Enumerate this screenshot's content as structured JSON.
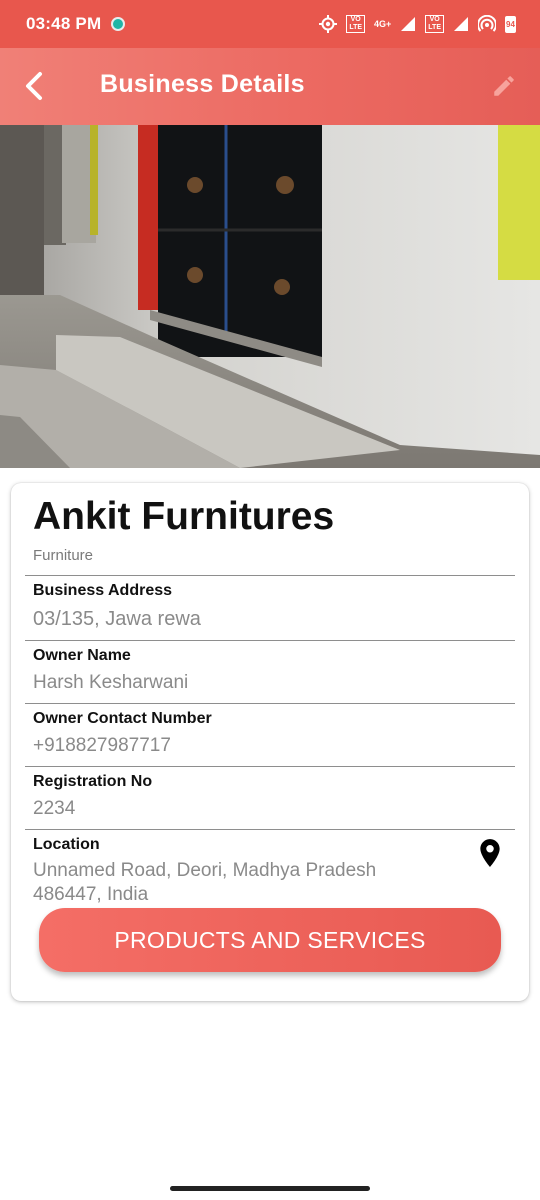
{
  "status_bar": {
    "time": "03:48 PM",
    "network_1": "VO\nLTE",
    "network_tag": "4G+",
    "network_2": "VO\nLTE",
    "battery": "94"
  },
  "app_bar": {
    "title": "Business Details",
    "back_icon": "chevron-left-icon",
    "edit_icon": "pencil-icon"
  },
  "business": {
    "name": "Ankit Furnitures",
    "category": "Furniture"
  },
  "fields": {
    "address": {
      "label": "Business Address",
      "value": "03/135, Jawa rewa"
    },
    "owner": {
      "label": "Owner Name",
      "value": "Harsh Kesharwani"
    },
    "contact": {
      "label": "Owner Contact Number",
      "value": "+918827987717"
    },
    "registration": {
      "label": "Registration No",
      "value": "2234"
    },
    "location": {
      "label": "Location",
      "value_line1": "Unnamed Road, Deori, Madhya Pradesh",
      "value_line2": "486447, India"
    }
  },
  "cta": {
    "label": "PRODUCTS AND SERVICES"
  },
  "colors": {
    "status_bar": "#e8574d",
    "app_bar_start": "#f08077",
    "app_bar_end": "#e55e57",
    "button_start": "#f46e66",
    "button_end": "#e85a52"
  }
}
